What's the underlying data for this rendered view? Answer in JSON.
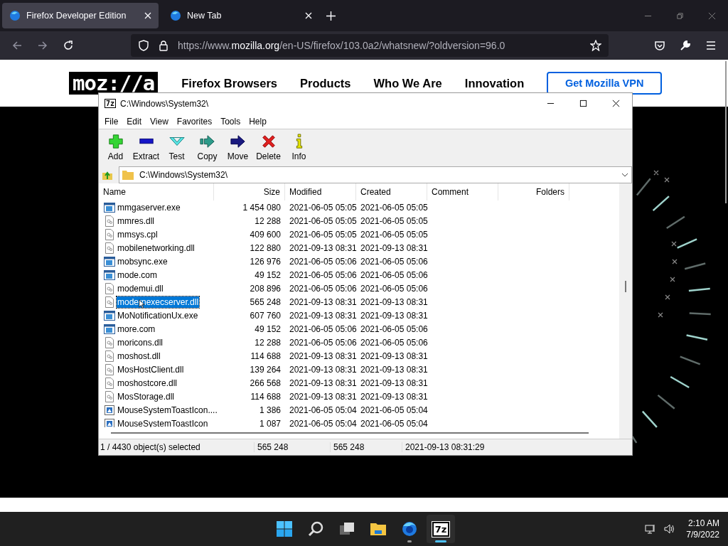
{
  "browser": {
    "tabs": [
      {
        "title": "Firefox Developer Edition",
        "selected": true
      },
      {
        "title": "New Tab",
        "selected": false
      }
    ],
    "url_prefix": "https://www.",
    "url_domain": "mozilla.org",
    "url_path": "/en-US/firefox/103.0a2/whatsnew/?oldversion=96.0"
  },
  "page": {
    "logo": "moz://a",
    "nav": [
      "Firefox Browsers",
      "Products",
      "Who We Are",
      "Innovation"
    ],
    "cta": "Get Mozilla VPN"
  },
  "archiver": {
    "icon_text": "7z",
    "title": "C:\\Windows\\System32\\",
    "menu": [
      "File",
      "Edit",
      "View",
      "Favorites",
      "Tools",
      "Help"
    ],
    "tools": [
      {
        "kind": "add",
        "label": "Add"
      },
      {
        "kind": "extract",
        "label": "Extract"
      },
      {
        "kind": "test",
        "label": "Test"
      },
      {
        "kind": "copy",
        "label": "Copy"
      },
      {
        "kind": "move",
        "label": "Move"
      },
      {
        "kind": "delete",
        "label": "Delete"
      },
      {
        "kind": "info",
        "label": "Info"
      }
    ],
    "path": "C:\\Windows\\System32\\",
    "columns": [
      "Name",
      "Size",
      "Modified",
      "Created",
      "Comment",
      "Folders"
    ],
    "rows": [
      {
        "kind": "app",
        "name": "mmgaserver.exe",
        "size": "1 454 080",
        "modified": "2021-06-05 05:05",
        "created": "2021-06-05 05:05",
        "selected": false
      },
      {
        "kind": "library",
        "name": "mmres.dll",
        "size": "12 288",
        "modified": "2021-06-05 05:05",
        "created": "2021-06-05 05:05",
        "selected": false
      },
      {
        "kind": "library",
        "name": "mmsys.cpl",
        "size": "409 600",
        "modified": "2021-06-05 05:05",
        "created": "2021-06-05 05:05",
        "selected": false
      },
      {
        "kind": "library",
        "name": "mobilenetworking.dll",
        "size": "122 880",
        "modified": "2021-09-13 08:31",
        "created": "2021-09-13 08:31",
        "selected": false
      },
      {
        "kind": "app",
        "name": "mobsync.exe",
        "size": "126 976",
        "modified": "2021-06-05 05:06",
        "created": "2021-06-05 05:06",
        "selected": false
      },
      {
        "kind": "app",
        "name": "mode.com",
        "size": "49 152",
        "modified": "2021-06-05 05:06",
        "created": "2021-06-05 05:06",
        "selected": false
      },
      {
        "kind": "library",
        "name": "modemui.dll",
        "size": "208 896",
        "modified": "2021-06-05 05:06",
        "created": "2021-06-05 05:06",
        "selected": false
      },
      {
        "kind": "library",
        "name": "modernexecserver.dll",
        "size": "565 248",
        "modified": "2021-09-13 08:31",
        "created": "2021-09-13 08:31",
        "selected": true
      },
      {
        "kind": "app",
        "name": "MoNotificationUx.exe",
        "size": "607 760",
        "modified": "2021-09-13 08:31",
        "created": "2021-09-13 08:31",
        "selected": false
      },
      {
        "kind": "app",
        "name": "more.com",
        "size": "49 152",
        "modified": "2021-06-05 05:06",
        "created": "2021-06-05 05:06",
        "selected": false
      },
      {
        "kind": "library",
        "name": "moricons.dll",
        "size": "12 288",
        "modified": "2021-06-05 05:06",
        "created": "2021-06-05 05:06",
        "selected": false
      },
      {
        "kind": "library",
        "name": "moshost.dll",
        "size": "114 688",
        "modified": "2021-09-13 08:31",
        "created": "2021-09-13 08:31",
        "selected": false
      },
      {
        "kind": "library",
        "name": "MosHostClient.dll",
        "size": "139 264",
        "modified": "2021-09-13 08:31",
        "created": "2021-09-13 08:31",
        "selected": false
      },
      {
        "kind": "library",
        "name": "moshostcore.dll",
        "size": "266 568",
        "modified": "2021-09-13 08:31",
        "created": "2021-09-13 08:31",
        "selected": false
      },
      {
        "kind": "library",
        "name": "MosStorage.dll",
        "size": "114 688",
        "modified": "2021-09-13 08:31",
        "created": "2021-09-13 08:31",
        "selected": false
      },
      {
        "kind": "image",
        "name": "MouseSystemToastIcon....",
        "size": "1 386",
        "modified": "2021-06-05 05:04",
        "created": "2021-06-05 05:04",
        "selected": false
      },
      {
        "kind": "image",
        "name": "MouseSystemToastIcon",
        "size": "1 087",
        "modified": "2021-06-05 05:04",
        "created": "2021-06-05 05:04",
        "selected": false
      }
    ],
    "status": [
      "1 / 4430 object(s) selected",
      "565 248",
      "565 248",
      "2021-09-13 08:31:29"
    ]
  },
  "taskbar": {
    "apps": [
      {
        "kind": "start",
        "running": false,
        "selected": false
      },
      {
        "kind": "search",
        "running": false,
        "selected": false
      },
      {
        "kind": "taskview",
        "running": false,
        "selected": false
      },
      {
        "kind": "explorer",
        "running": false,
        "selected": false
      },
      {
        "kind": "firefox",
        "running": true,
        "selected": false
      },
      {
        "kind": "archiver",
        "label": "7z",
        "running": true,
        "selected": true
      }
    ],
    "time": "2:10 AM",
    "date": "7/9/2022"
  }
}
